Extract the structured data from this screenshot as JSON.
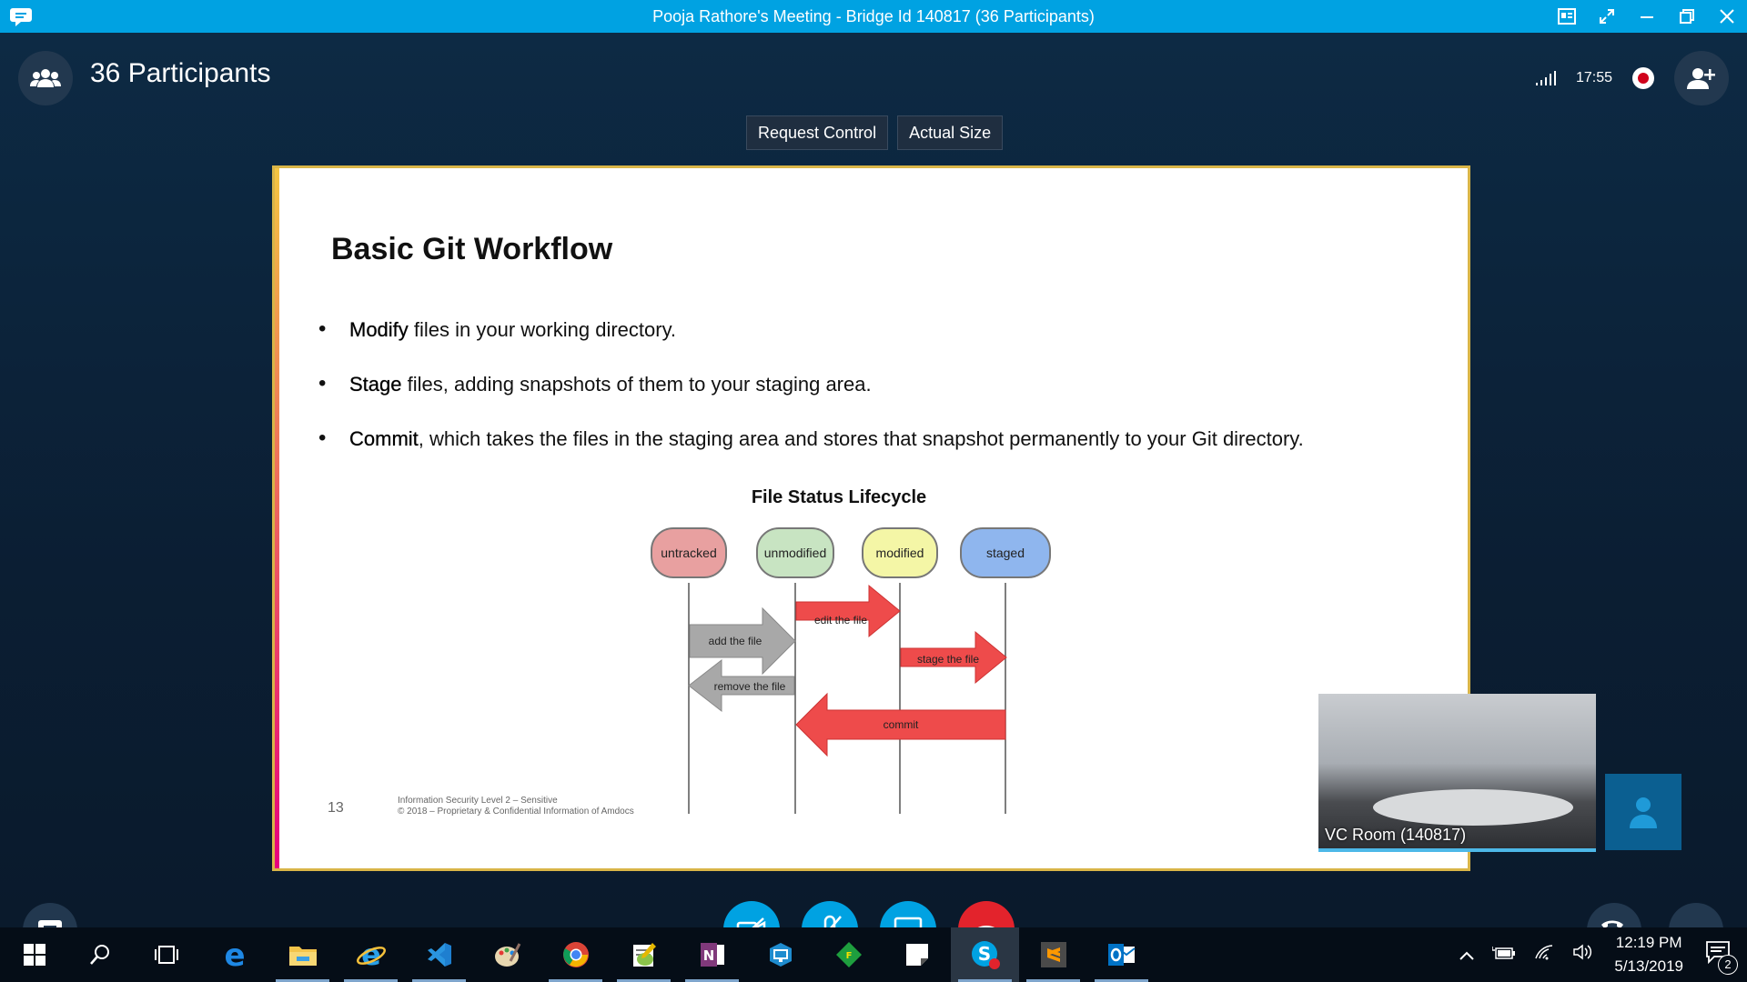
{
  "window": {
    "title": "Pooja Rathore's Meeting - Bridge Id 140817 (36 Participants)"
  },
  "header": {
    "participants_label": "36 Participants",
    "call_timer": "17:55"
  },
  "share_controls": {
    "request_control": "Request Control",
    "actual_size": "Actual Size"
  },
  "slide": {
    "title": "Basic Git Workflow",
    "bullets": [
      {
        "bold": "Modify",
        "rest": " files in your working directory."
      },
      {
        "bold": "Stage",
        "rest": " files, adding snapshots of them to your staging area."
      },
      {
        "bold": "Commit",
        "rest": ", which takes the files in the staging area and stores that snapshot permanently to your Git directory."
      }
    ],
    "diagram": {
      "title": "File Status Lifecycle",
      "states": [
        "untracked",
        "unmodified",
        "modified",
        "staged"
      ],
      "arrows": [
        "add the file",
        "edit the file",
        "stage the file",
        "remove the file",
        "commit"
      ]
    },
    "page_number": "13",
    "footer_line1": "Information Security Level 2 – Sensitive",
    "footer_line2": "© 2018 – Proprietary & Confidential Information of Amdocs"
  },
  "video": {
    "label": "VC Room (140817)"
  },
  "taskbar": {
    "time": "12:19 PM",
    "date": "5/13/2019",
    "notification_count": "2"
  },
  "colors": {
    "skype_blue": "#00a2e2",
    "end_call_red": "#e3232c",
    "untracked": "#e8a0a0",
    "unmodified": "#c8e4c2",
    "modified": "#f4f6a6",
    "staged": "#8fb6ee",
    "arrow_red": "#ee4b4b",
    "arrow_gray": "#a8a8a8"
  }
}
